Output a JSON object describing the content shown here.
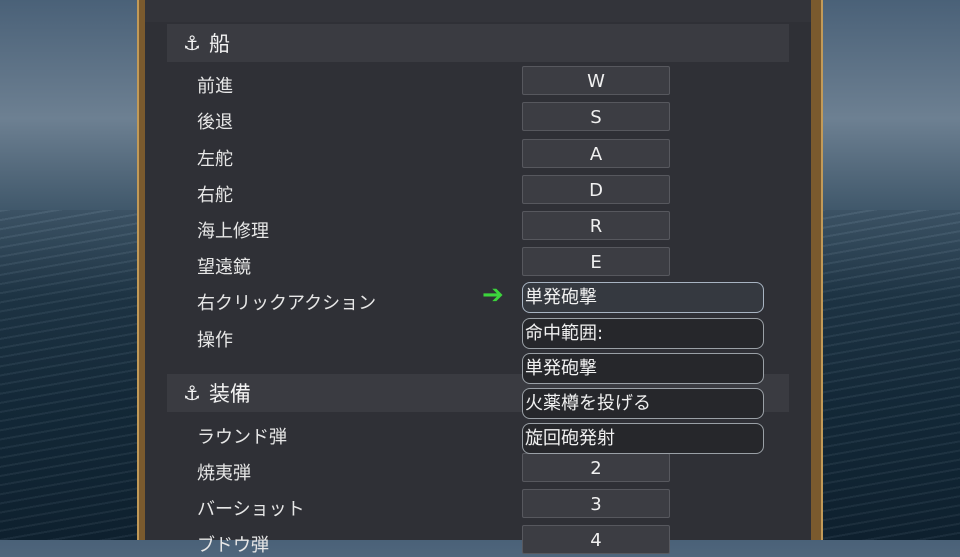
{
  "sections": {
    "ship": {
      "icon": "anchor-icon",
      "title": "船",
      "rows": [
        {
          "label": "前進",
          "key": "W"
        },
        {
          "label": "後退",
          "key": "S"
        },
        {
          "label": "左舵",
          "key": "A"
        },
        {
          "label": "右舵",
          "key": "D"
        },
        {
          "label": "海上修理",
          "key": "R"
        },
        {
          "label": "望遠鏡",
          "key": "E"
        },
        {
          "label": "右クリックアクション",
          "key": "単発砲撃"
        },
        {
          "label": "操作",
          "key": ""
        }
      ]
    },
    "equipment": {
      "icon": "anchor-icon",
      "title": "装備",
      "rows": [
        {
          "label": "ラウンド弾",
          "key": ""
        },
        {
          "label": "焼夷弾",
          "key": "2"
        },
        {
          "label": "バーショット",
          "key": "3"
        },
        {
          "label": "ブドウ弾",
          "key": "4"
        }
      ]
    }
  },
  "dropdown": {
    "selected": "単発砲撃",
    "options": [
      "命中範囲:",
      "単発砲撃",
      "火薬樽を投げる",
      "旋回砲発射"
    ]
  },
  "pointer": {
    "icon": "arrow-right-icon",
    "color": "#3cd43c"
  }
}
